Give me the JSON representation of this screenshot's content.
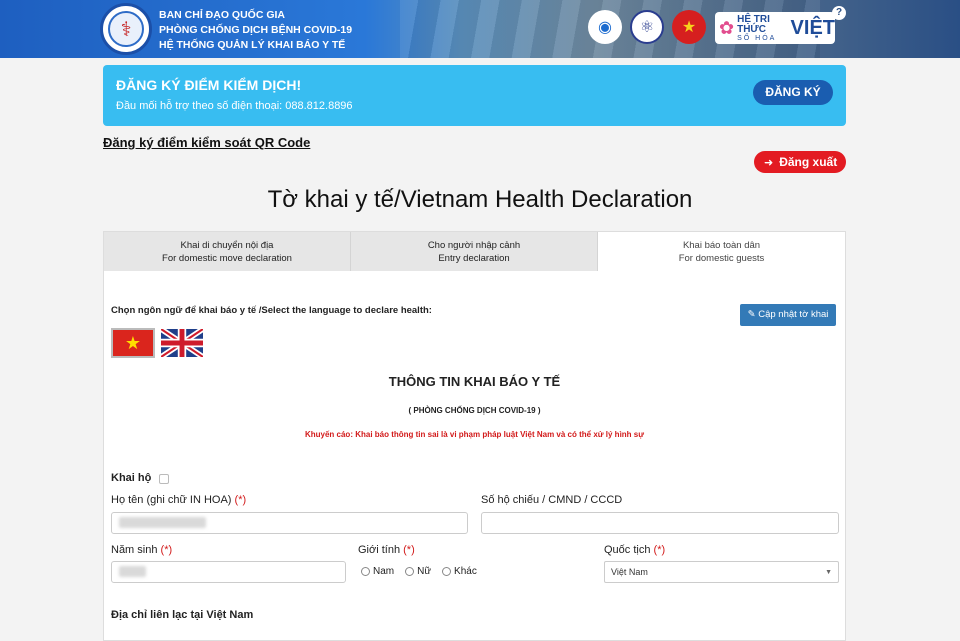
{
  "header": {
    "line1": "BAN CHỈ ĐẠO QUỐC GIA",
    "line2": "PHÒNG CHỐNG DỊCH BỆNH COVID-19",
    "line3": "HỆ THỐNG QUẢN LÝ KHAI BÁO Y TẾ",
    "partner_brand": "VIỆT",
    "partner_top": "HỆ TRI THỨC",
    "partner_sub": "SỐ HÓA",
    "help": "?"
  },
  "alert": {
    "title": "ĐĂNG KÝ ĐIỂM KIỂM DỊCH!",
    "subtitle": "Đầu mối hỗ trợ theo số điện thoại: 088.812.8896",
    "button": "ĐĂNG KÝ",
    "bg_color": "#38bdf1"
  },
  "qr_link": "Đăng ký điểm kiểm soát QR Code",
  "logout": "Đăng xuất",
  "page_title": "Tờ khai y tế/Vietnam Health Declaration",
  "tabs": [
    {
      "line1": "Khai di chuyển nội địa",
      "line2": "For domestic move declaration",
      "active": false
    },
    {
      "line1": "Cho người nhập cảnh",
      "line2": "Entry declaration",
      "active": false
    },
    {
      "line1": "Khai báo toàn dân",
      "line2": "For domestic guests",
      "active": true
    }
  ],
  "language_label": "Chọn ngôn ngữ để khai báo y tế /Select the language to declare health:",
  "update_button": "Cập nhật tờ khai",
  "flags": [
    "vietnam-flag",
    "uk-flag"
  ],
  "form": {
    "heading": "THÔNG TIN KHAI BÁO Y TẾ",
    "subheading": "( PHÒNG CHỐNG DỊCH COVID-19 )",
    "warning": "Khuyến cáo: Khai báo thông tin sai là vi phạm pháp luật Việt Nam và có thể xử lý hình sự",
    "khai_ho": "Khai hộ",
    "name_label": "Họ tên (ghi chữ IN HOA)",
    "passport_label": "Số hộ chiếu / CMND / CCCD",
    "birth_label": "Năm sinh",
    "gender_label": "Giới tính",
    "nationality_label": "Quốc tịch",
    "required": "(*)",
    "gender_options": [
      "Nam",
      "Nữ",
      "Khác"
    ],
    "nationality_value": "Việt Nam",
    "address_section": "Địa chỉ liên lạc tại Việt Nam"
  }
}
